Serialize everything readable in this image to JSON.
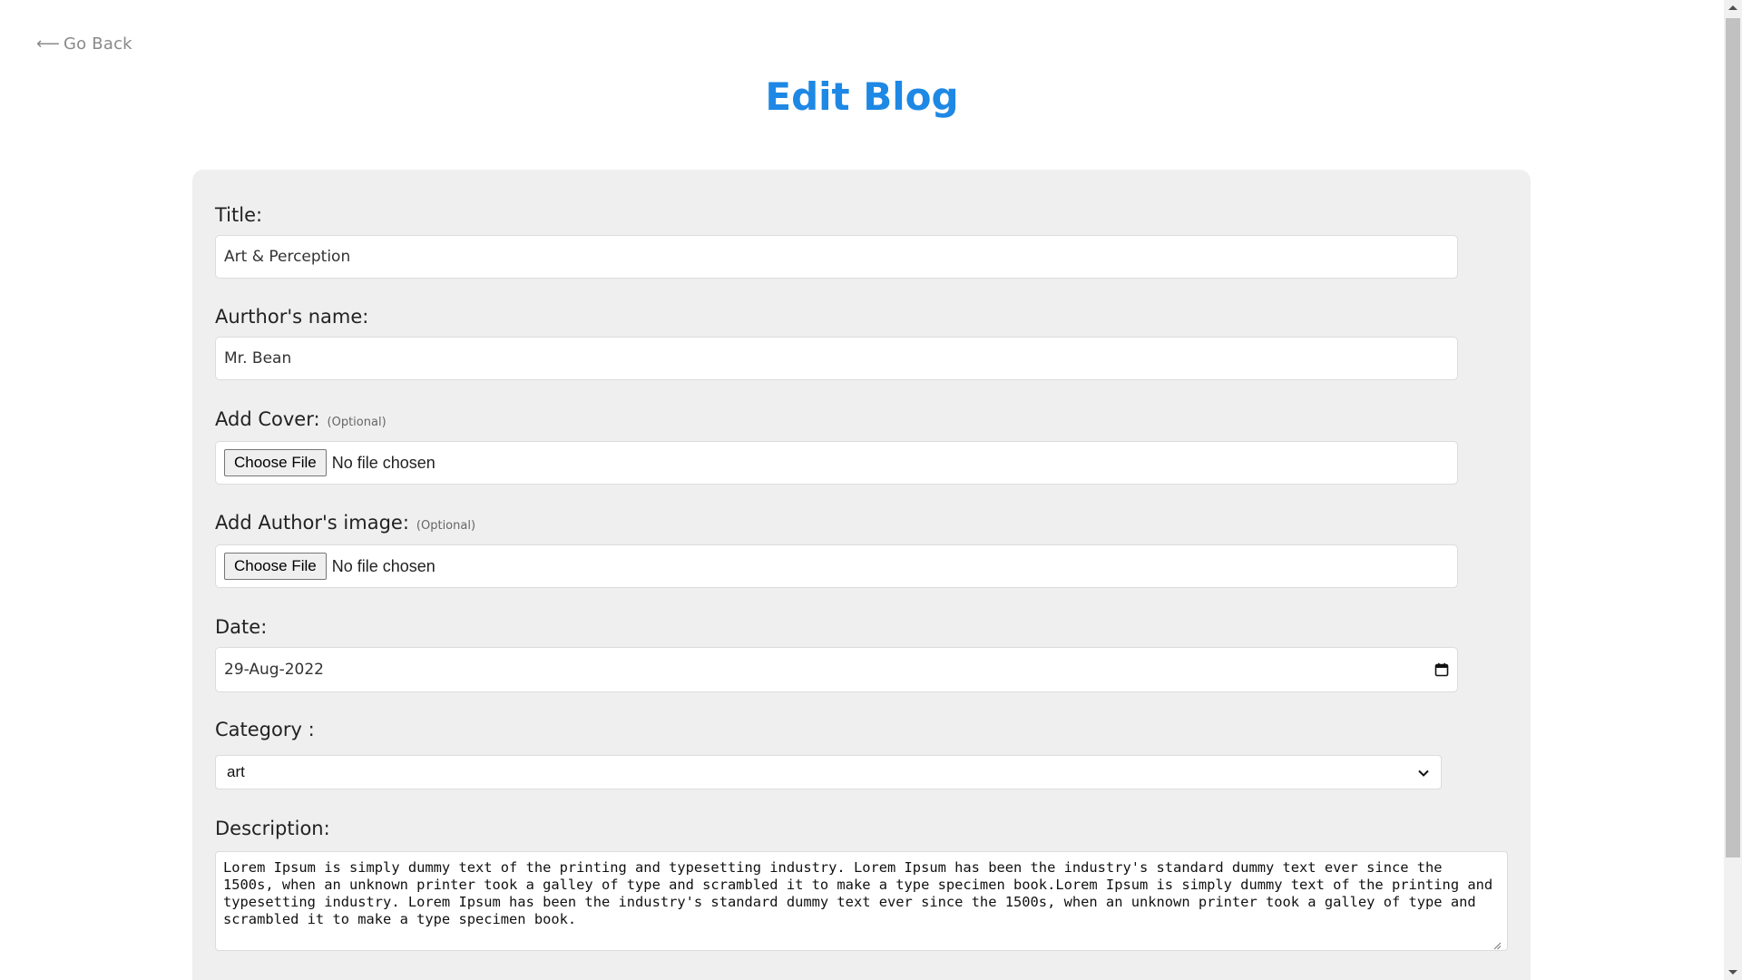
{
  "nav": {
    "back_arrow": "⟵",
    "back_label": "Go Back"
  },
  "header": {
    "title": "Edit Blog"
  },
  "form": {
    "title": {
      "label": "Title:",
      "value": "Art & Perception"
    },
    "author": {
      "label": "Aurthor's name:",
      "value": "Mr. Bean"
    },
    "cover": {
      "label": "Add Cover:",
      "optional": "(Optional)",
      "button": "Choose File",
      "status": "No file chosen"
    },
    "author_image": {
      "label": "Add Author's image:",
      "optional": "(Optional)",
      "button": "Choose File",
      "status": "No file chosen"
    },
    "date": {
      "label": "Date:",
      "value": "29-Aug-2022",
      "icon": "calendar-icon"
    },
    "category": {
      "label": "Category :",
      "selected": "art",
      "icon": "chevron-down-icon"
    },
    "description": {
      "label": "Description:",
      "value": "Lorem Ipsum is simply dummy text of the printing and typesetting industry. Lorem Ipsum has been the industry's standard dummy text ever since the 1500s, when an unknown printer took a galley of type and scrambled it to make a type specimen book.Lorem Ipsum is simply dummy text of the printing and typesetting industry. Lorem Ipsum has been the industry's standard dummy text ever since the 1500s, when an unknown printer took a galley of type and scrambled it to make a type specimen book."
    }
  },
  "colors": {
    "accent": "#1e88e5",
    "card_bg": "#efefef"
  }
}
